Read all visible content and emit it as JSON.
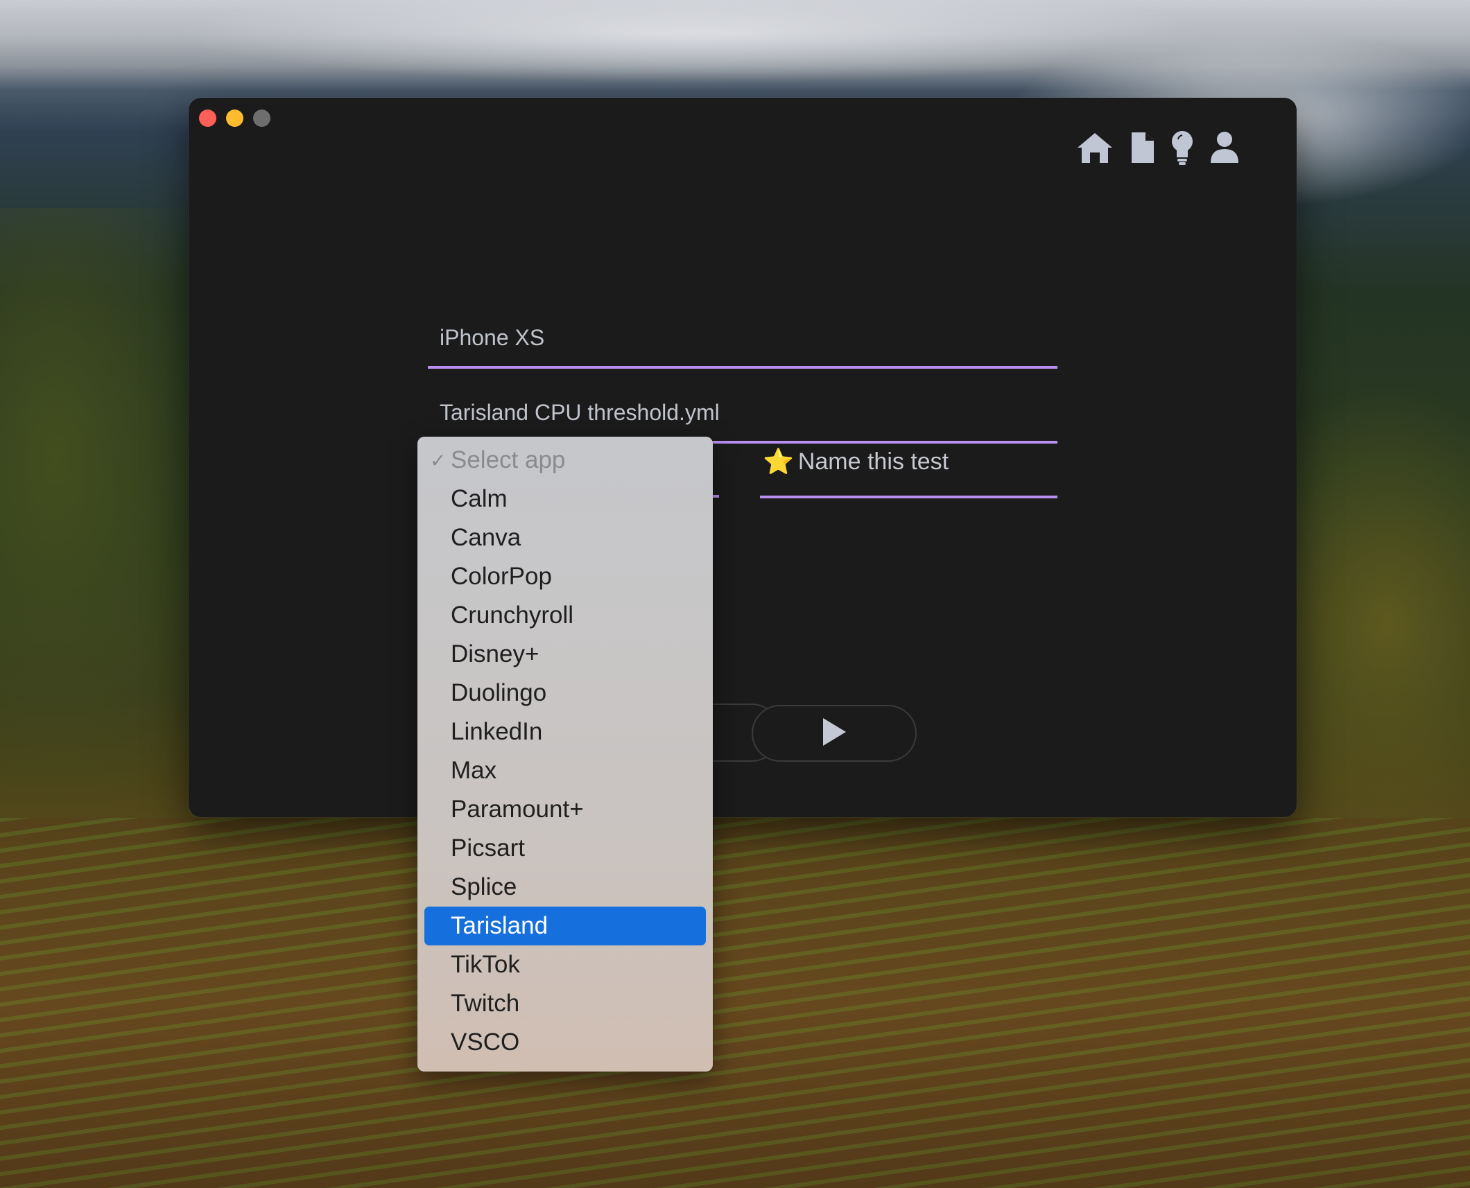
{
  "window": {
    "traffic_lights": [
      "close",
      "minimize",
      "zoom"
    ]
  },
  "toolbar": {
    "icons": [
      "home-icon",
      "document-icon",
      "lightbulb-icon",
      "user-icon"
    ]
  },
  "form": {
    "device_value": "iPhone XS",
    "config_value": "Tarisland CPU threshold.yml",
    "test_name_star": "⭐",
    "test_name_placeholder": "Name this test"
  },
  "app_dropdown": {
    "checkmark": "✓",
    "placeholder": "Select app",
    "options": [
      "Calm",
      "Canva",
      "ColorPop",
      "Crunchyroll",
      "Disney+",
      "Duolingo",
      "LinkedIn",
      "Max",
      "Paramount+",
      "Picsart",
      "Splice",
      "Tarisland",
      "TikTok",
      "Twitch",
      "VSCO"
    ],
    "highlighted": "Tarisland"
  },
  "buttons": {
    "run_icon": "play-icon"
  },
  "colors": {
    "accent_underline": "#b98ef3",
    "highlight": "#1570de",
    "window_bg": "#1b1b1b"
  }
}
